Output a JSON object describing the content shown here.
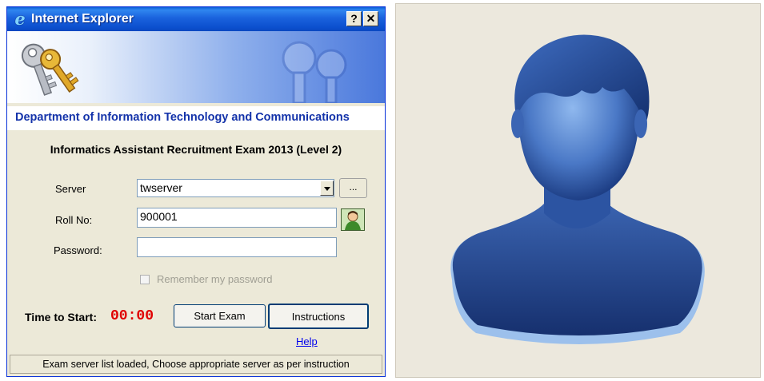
{
  "window": {
    "title": "Internet Explorer",
    "help_label": "?",
    "close_label": "✕"
  },
  "banner": {
    "icon": "keys-icon"
  },
  "department": "Department of Information Technology and Communications",
  "exam_title": "Informatics Assistant Recruitment Exam 2013 (Level 2)",
  "form": {
    "server_label": "Server",
    "server_value": "twserver",
    "browse_label": "...",
    "rollno_label": "Roll No:",
    "rollno_value": "900001",
    "password_label": "Password:",
    "password_value": "",
    "remember_label": "Remember my password",
    "remember_checked": false
  },
  "actions": {
    "time_to_start_label": "Time to Start:",
    "timer_value": "00:00",
    "start_label": "Start Exam",
    "instructions_label": "Instructions",
    "help_label": "Help"
  },
  "status": "Exam server list loaded, Choose appropriate server as per instruction",
  "colors": {
    "titlebar": "#1a62dd",
    "department_text": "#1433aa",
    "timer": "#e00000",
    "link": "#0000ee",
    "avatar_background": "#ece8dd",
    "avatar_blue": "#2a52a0"
  }
}
